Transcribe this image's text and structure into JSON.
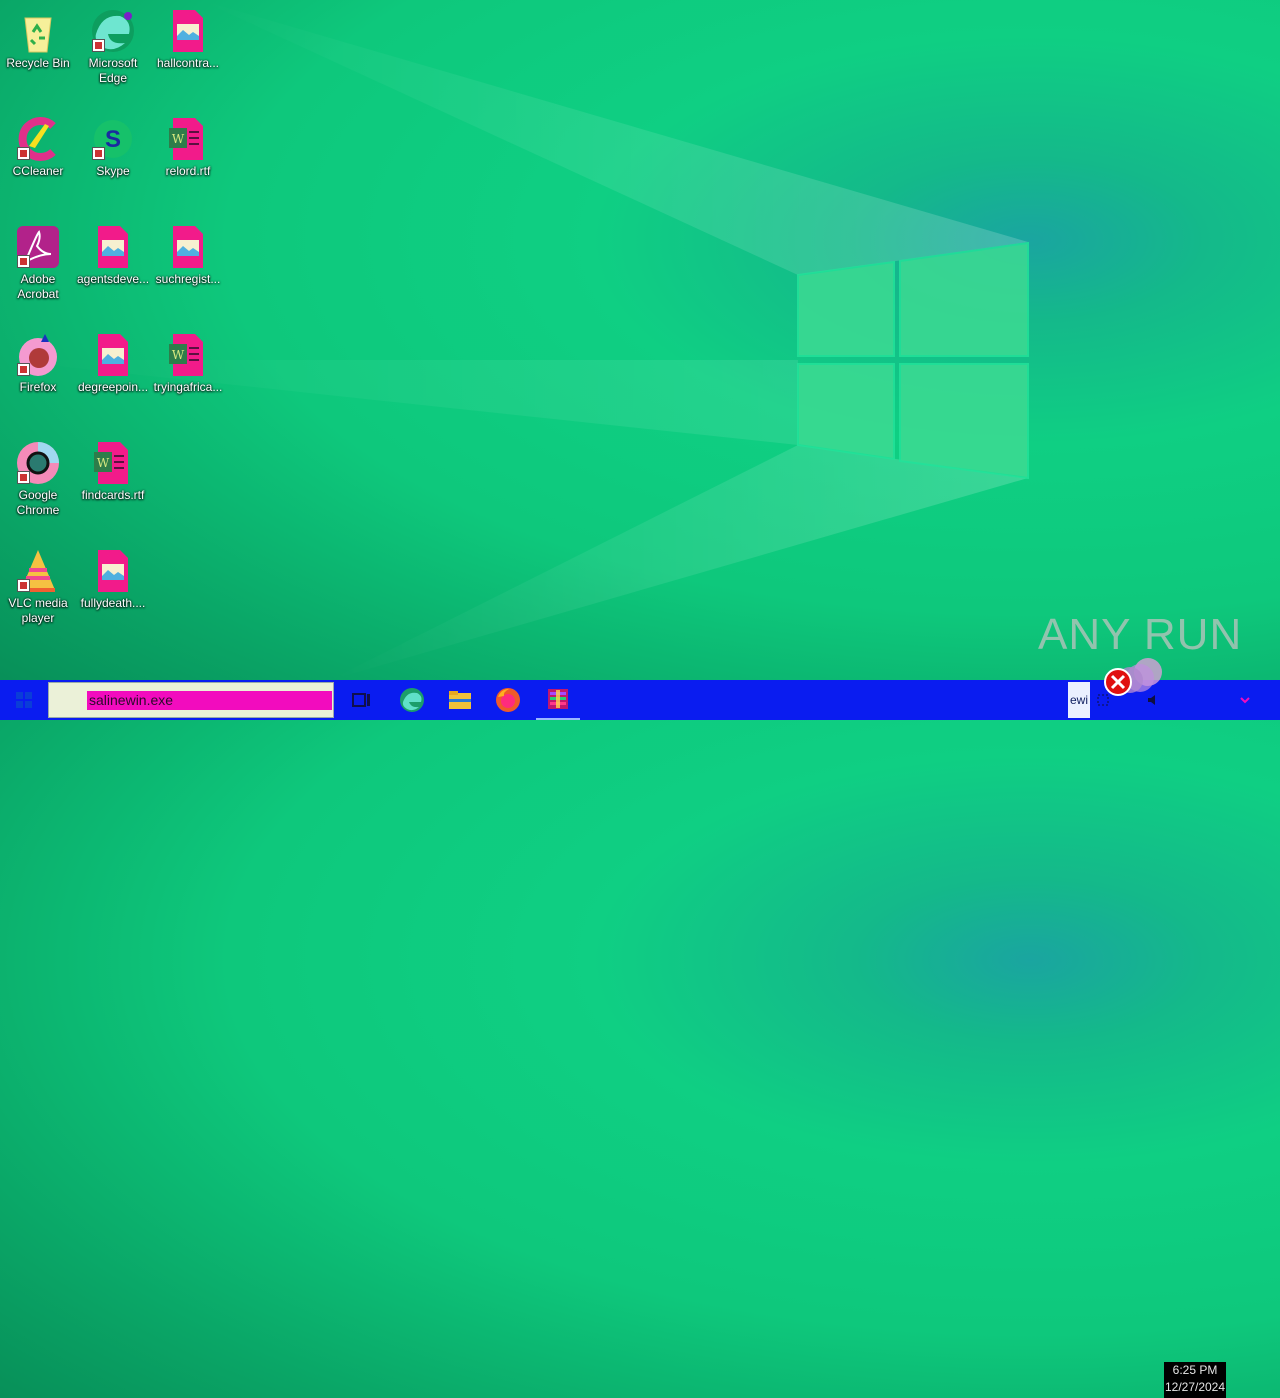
{
  "desktop": {
    "icons": [
      {
        "label": "Recycle Bin",
        "icon": "recycle-bin-icon"
      },
      {
        "label": "Microsoft Edge",
        "icon": "edge-icon"
      },
      {
        "label": "hallcontra...",
        "icon": "image-file-icon"
      },
      {
        "label": "CCleaner",
        "icon": "ccleaner-icon"
      },
      {
        "label": "Skype",
        "icon": "skype-icon"
      },
      {
        "label": "relord.rtf",
        "icon": "rtf-file-icon"
      },
      {
        "label": "Adobe Acrobat",
        "icon": "acrobat-icon"
      },
      {
        "label": "agentsdeve...",
        "icon": "image-file-icon"
      },
      {
        "label": "suchregist...",
        "icon": "image-file-icon"
      },
      {
        "label": "Firefox",
        "icon": "firefox-icon"
      },
      {
        "label": "degreepoin...",
        "icon": "image-file-icon"
      },
      {
        "label": "tryingafrica...",
        "icon": "rtf-file-icon"
      },
      {
        "label": "Google Chrome",
        "icon": "chrome-icon"
      },
      {
        "label": "findcards.rtf",
        "icon": "rtf-file-icon"
      },
      {
        "label": "VLC media player",
        "icon": "vlc-icon"
      },
      {
        "label": "fullydeath....",
        "icon": "image-file-icon"
      }
    ]
  },
  "taskbar": {
    "search_text": "salinewin.exe",
    "pinned": [
      "task-view-icon",
      "edge-icon",
      "file-explorer-icon",
      "firefox-icon",
      "winrar-icon"
    ],
    "tray_label": "ewi",
    "clock_time": "6:25 PM",
    "clock_date": "12/27/2024"
  },
  "watermark": "ANY RUN",
  "colors": {
    "taskbar": "#0a1cf0",
    "search_highlight": "#f20cbe",
    "desktop": "#0ec87c"
  }
}
